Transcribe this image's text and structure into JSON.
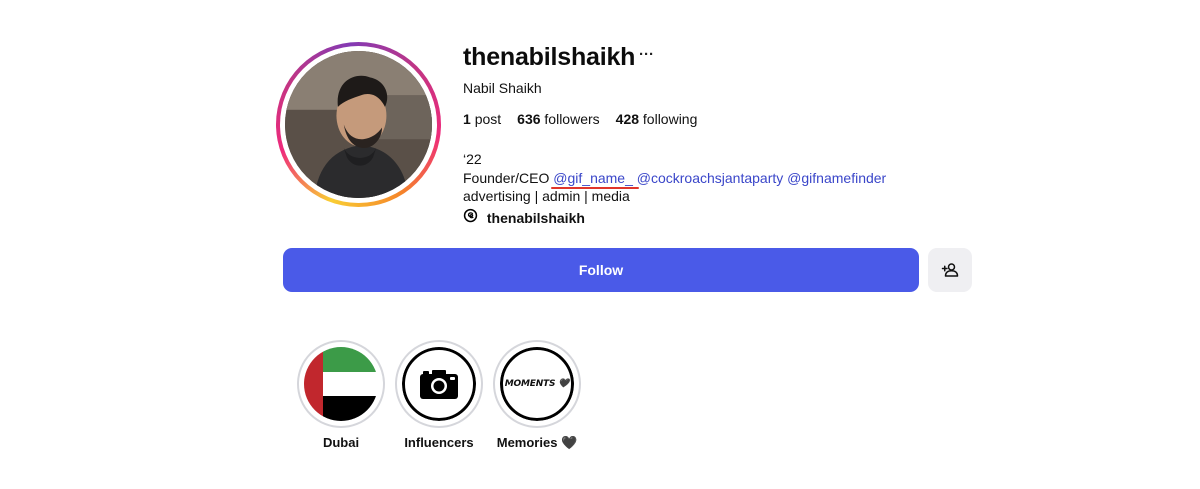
{
  "profile": {
    "username": "thenabilshaikh",
    "more_label": "···",
    "full_name": "Nabil Shaikh"
  },
  "stats": {
    "posts_count": "1",
    "posts_label": "post",
    "followers_count": "636",
    "followers_label": "followers",
    "following_count": "428",
    "following_label": "following"
  },
  "bio": {
    "line1": "‘22",
    "founder_prefix": "Founder/",
    "ceo": "CEO",
    "mention1": "@gif_name_",
    "mention2": "@cockroachsjantaparty",
    "mention3": "@gifnamefinder",
    "line3": "advertising | admin | media",
    "threads_handle": "thenabilshaikh"
  },
  "actions": {
    "follow_label": "Follow",
    "add_user_icon": "add-person-icon"
  },
  "highlights": [
    {
      "label": "Dubai",
      "cover": "uae-flag"
    },
    {
      "label": "Influencers",
      "cover": "camera-icon"
    },
    {
      "label": "Memories 🖤",
      "cover_text": "MOMENTS 🖤"
    }
  ],
  "colors": {
    "follow_button": "#4a5ae8",
    "mention_link": "#3a46c9",
    "underline_annotation": "#e0352b"
  }
}
